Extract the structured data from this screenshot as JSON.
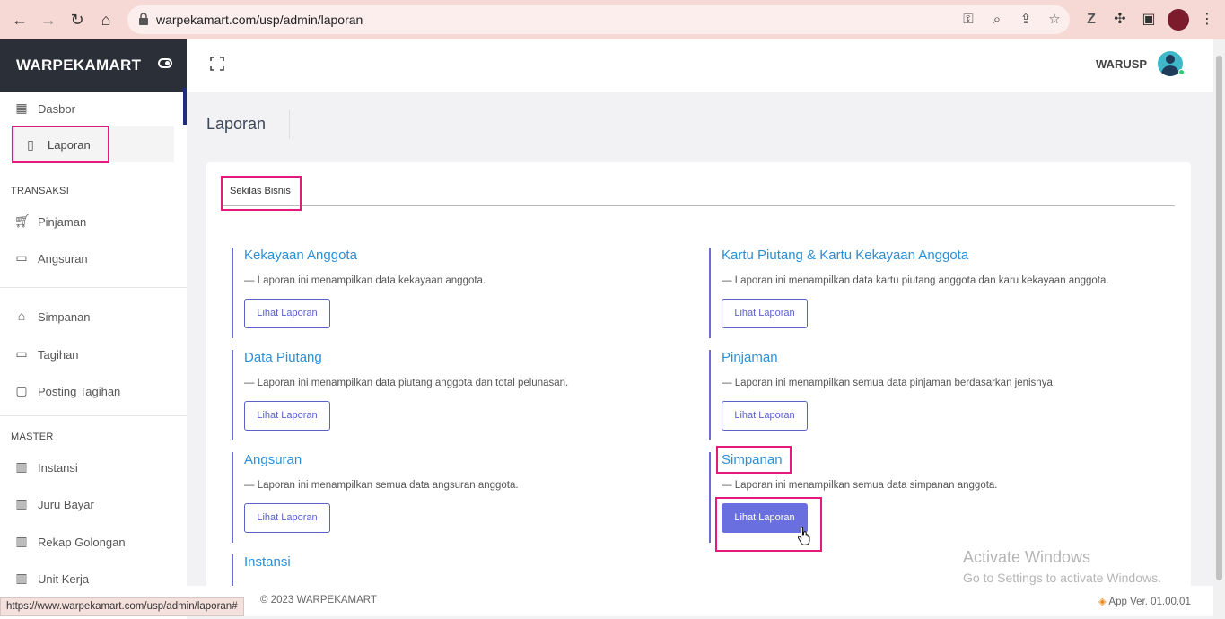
{
  "browser": {
    "url": "warpekamart.com/usp/admin/laporan",
    "status_url": "https://www.warpekamart.com/usp/admin/laporan#"
  },
  "sidebar": {
    "brand": "WARPEKAMART",
    "items": [
      {
        "label": "Dasbor",
        "icon": "map-icon"
      },
      {
        "label": "Laporan",
        "icon": "clipboard-icon"
      },
      {
        "label": "Pinjaman",
        "icon": "cart-icon"
      },
      {
        "label": "Angsuran",
        "icon": "money-icon"
      },
      {
        "label": "Simpanan",
        "icon": "bank-icon"
      },
      {
        "label": "Tagihan",
        "icon": "money-icon"
      },
      {
        "label": "Posting Tagihan",
        "icon": "note-icon"
      },
      {
        "label": "Instansi",
        "icon": "book-icon"
      },
      {
        "label": "Juru Bayar",
        "icon": "book-icon"
      },
      {
        "label": "Rekap Golongan",
        "icon": "book-icon"
      },
      {
        "label": "Unit Kerja",
        "icon": "book-icon"
      }
    ],
    "sections": {
      "transaksi": "TRANSAKSI",
      "master": "MASTER"
    }
  },
  "topbar": {
    "user": "WARUSP"
  },
  "page": {
    "title": "Laporan",
    "tab": "Sekilas Bisnis",
    "button_label": "Lihat Laporan",
    "reports": [
      {
        "title": "Kekayaan Anggota",
        "desc": "— Laporan ini menampilkan data kekayaan anggota."
      },
      {
        "title": "Kartu Piutang & Kartu Kekayaan Anggota",
        "desc": "— Laporan ini menampilkan data kartu piutang anggota dan karu kekayaan anggota."
      },
      {
        "title": "Data Piutang",
        "desc": "— Laporan ini menampilkan data piutang anggota dan total pelunasan."
      },
      {
        "title": "Pinjaman",
        "desc": "— Laporan ini menampilkan semua data pinjaman berdasarkan jenisnya."
      },
      {
        "title": "Angsuran",
        "desc": "— Laporan ini menampilkan semua data angsuran anggota."
      },
      {
        "title": "Simpanan",
        "desc": "— Laporan ini menampilkan semua data simpanan anggota."
      },
      {
        "title": "Instansi",
        "desc": ""
      }
    ]
  },
  "watermark": {
    "line1": "Activate Windows",
    "line2": "Go to Settings to activate Windows."
  },
  "footer": {
    "copyright": "© 2023 WARPEKAMART",
    "version": "App Ver. 01.00.01"
  },
  "colors": {
    "accent": "#6a6fe0",
    "highlight": "#e5187c",
    "link": "#2c8fd6",
    "sidebar_dark": "#2b2f38"
  }
}
